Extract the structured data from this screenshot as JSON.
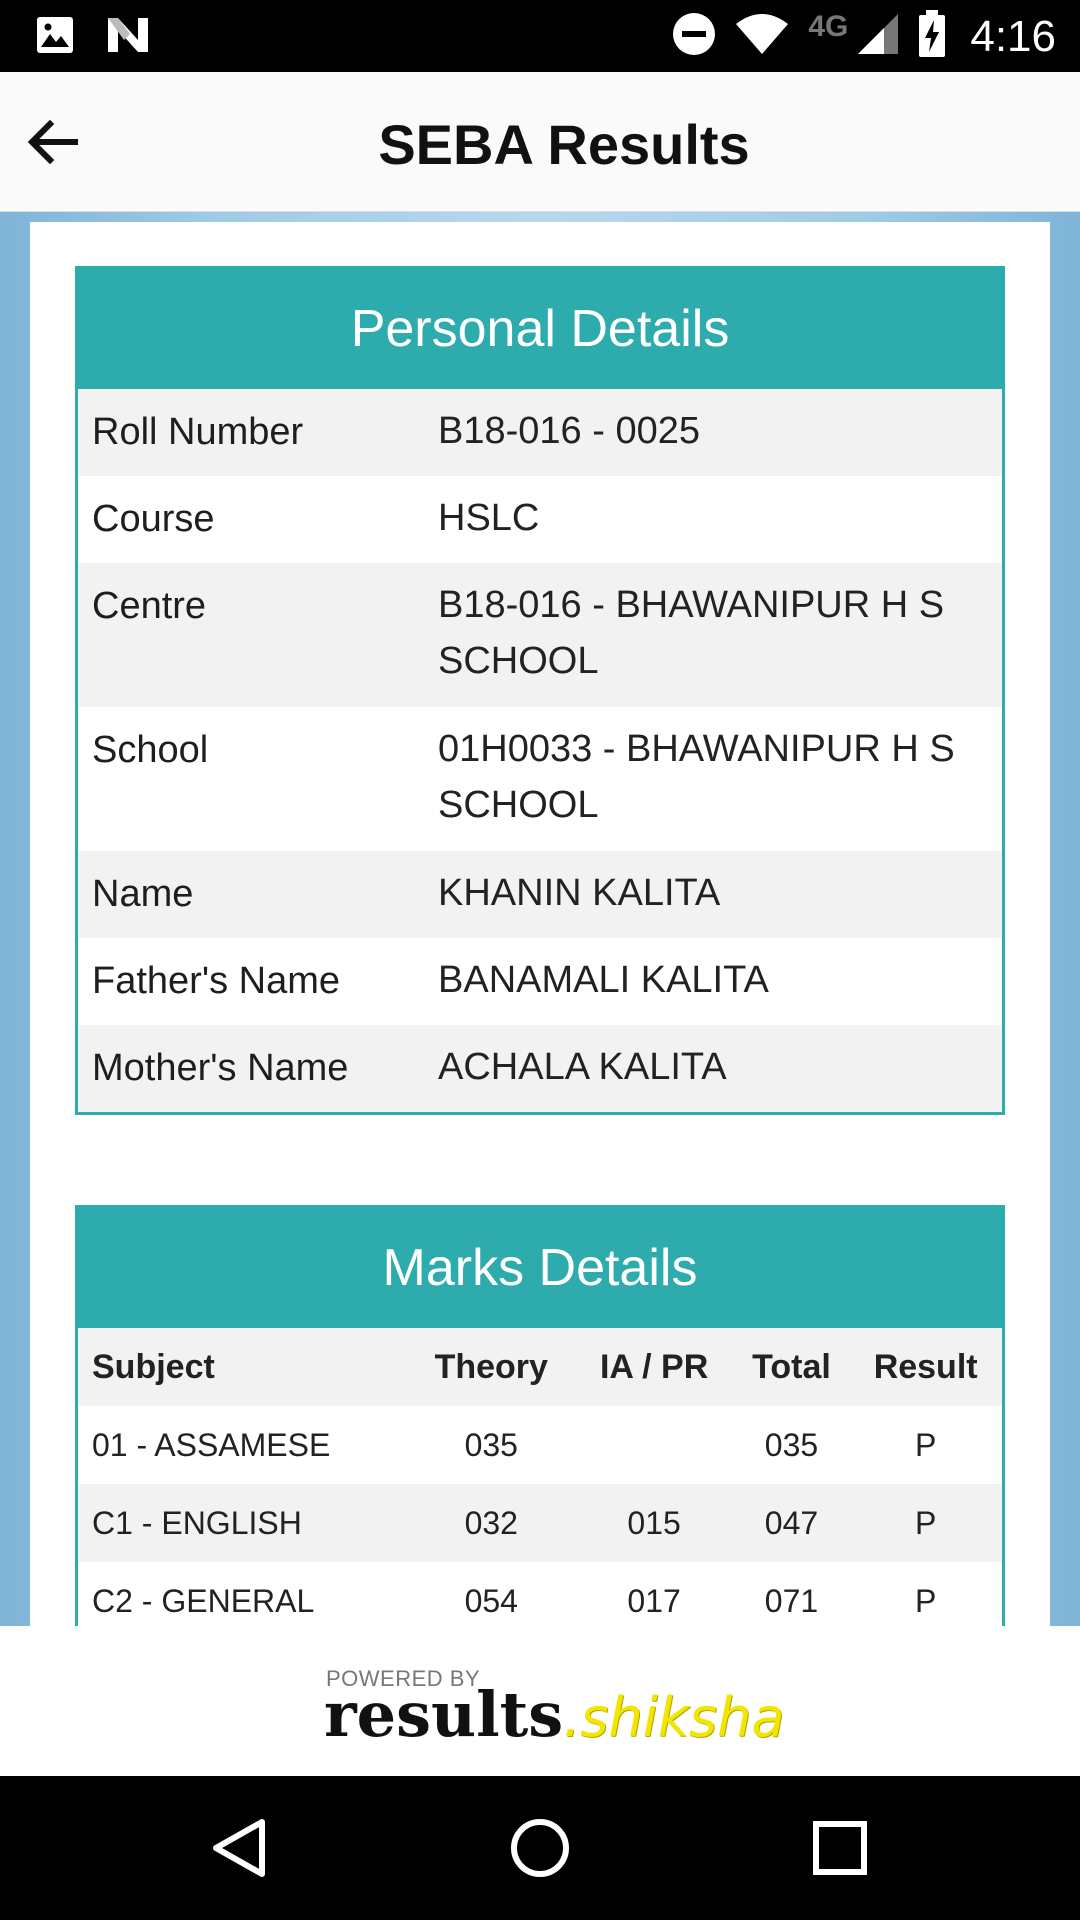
{
  "status_bar": {
    "time": "4:16",
    "network": "4G",
    "icons": [
      "image-icon",
      "n-icon",
      "do-not-disturb-icon",
      "wifi-icon",
      "signal-icon",
      "battery-charging-icon"
    ]
  },
  "app_bar": {
    "title": "SEBA Results",
    "back_icon": "back-arrow-icon"
  },
  "personal_details": {
    "heading": "Personal Details",
    "rows": [
      {
        "label": "Roll Number",
        "value": "B18-016 - 0025"
      },
      {
        "label": "Course",
        "value": "HSLC"
      },
      {
        "label": "Centre",
        "value": "B18-016 - BHAWANIPUR H S SCHOOL"
      },
      {
        "label": "School",
        "value": "01H0033 - BHAWANIPUR H S SCHOOL"
      },
      {
        "label": "Name",
        "value": "KHANIN KALITA"
      },
      {
        "label": "Father's Name",
        "value": "BANAMALI KALITA"
      },
      {
        "label": "Mother's Name",
        "value": "ACHALA KALITA"
      }
    ]
  },
  "marks_details": {
    "heading": "Marks Details",
    "columns": [
      "Subject",
      "Theory",
      "IA / PR",
      "Total",
      "Result"
    ],
    "rows": [
      {
        "subject": "01 - ASSAMESE",
        "theory": "035",
        "ia_pr": "",
        "total": "035",
        "result": "P"
      },
      {
        "subject": "C1 - ENGLISH",
        "theory": "032",
        "ia_pr": "015",
        "total": "047",
        "result": "P"
      },
      {
        "subject": "C2 - GENERAL",
        "theory": "054",
        "ia_pr": "017",
        "total": "071",
        "result": "P"
      }
    ]
  },
  "footer": {
    "powered_by": "POWERED BY",
    "logo_main": "results",
    "logo_dot": ".",
    "logo_accent": "shiksha"
  },
  "colors": {
    "accent": "#2eabad",
    "logo_yellow": "#f2e600",
    "background_blue": "#9fcbe6"
  },
  "nav_bar": {
    "icons": [
      "nav-back-icon",
      "nav-home-icon",
      "nav-recents-icon"
    ]
  }
}
